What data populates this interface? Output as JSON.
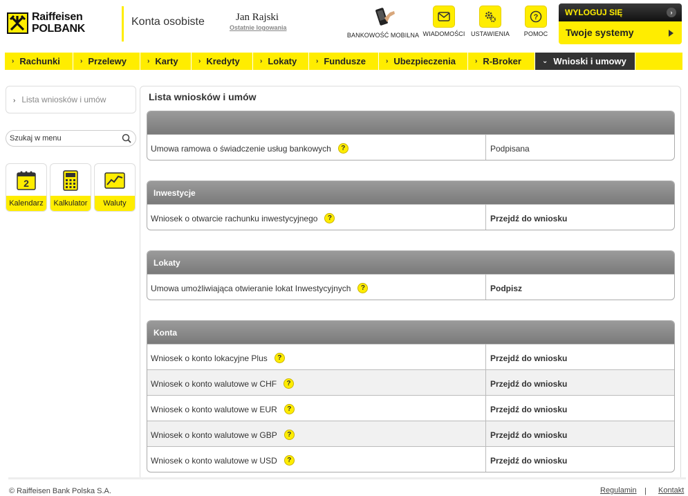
{
  "brand": {
    "line1": "Raiffeisen",
    "line2": "POLBANK",
    "accent": "#ffed00",
    "dark": "#333333"
  },
  "header": {
    "section_title": "Konta osobiste",
    "user_name": "Jan Rajski",
    "last_login_link": "Ostatnie logowania",
    "icons": [
      {
        "name": "mobile-banking-icon",
        "label": "BANKOWOŚĆ MOBILNA"
      },
      {
        "name": "messages-icon",
        "label": "WIADOMOŚCI"
      },
      {
        "name": "settings-icon",
        "label": "USTAWIENIA"
      },
      {
        "name": "help-icon",
        "label": "POMOC"
      }
    ],
    "logout_label": "WYLOGUJ SIĘ",
    "systems_label": "Twoje systemy"
  },
  "nav": {
    "items": [
      {
        "label": "Rachunki"
      },
      {
        "label": "Przelewy"
      },
      {
        "label": "Karty"
      },
      {
        "label": "Kredyty"
      },
      {
        "label": "Lokaty"
      },
      {
        "label": "Fundusze"
      },
      {
        "label": "Ubezpieczenia"
      },
      {
        "label": "R-Broker"
      },
      {
        "label": "Wnioski i umowy",
        "active": true
      }
    ]
  },
  "sidebar": {
    "menu_item": "Lista wniosków i umów",
    "search_placeholder": "Szukaj w menu",
    "tools": [
      {
        "label": "Kalendarz",
        "icon": "calendar-icon"
      },
      {
        "label": "Kalkulator",
        "icon": "calculator-icon"
      },
      {
        "label": "Waluty",
        "icon": "currency-chart-icon"
      }
    ]
  },
  "main": {
    "title": "Lista wniosków i umów",
    "groups": [
      {
        "title": "",
        "rows": [
          {
            "name": "Umowa ramowa o świadczenie usług bankowych",
            "action": "Podpisana",
            "bold": false
          }
        ]
      },
      {
        "title": "Inwestycje",
        "rows": [
          {
            "name": "Wniosek o otwarcie rachunku inwestycyjnego",
            "action": "Przejdź do wniosku",
            "bold": true
          }
        ]
      },
      {
        "title": "Lokaty",
        "rows": [
          {
            "name": "Umowa umożliwiająca otwieranie lokat Inwestycyjnych",
            "action": "Podpisz",
            "bold": true
          }
        ]
      },
      {
        "title": "Konta",
        "rows": [
          {
            "name": "Wniosek o konto lokacyjne Plus",
            "action": "Przejdź do wniosku",
            "bold": true
          },
          {
            "name": "Wniosek o konto walutowe w CHF",
            "action": "Przejdź do wniosku",
            "bold": true
          },
          {
            "name": "Wniosek o konto walutowe w EUR",
            "action": "Przejdź do wniosku",
            "bold": true
          },
          {
            "name": "Wniosek o konto walutowe w GBP",
            "action": "Przejdź do wniosku",
            "bold": true
          },
          {
            "name": "Wniosek o konto walutowe w USD",
            "action": "Przejdź do wniosku",
            "bold": true
          }
        ]
      }
    ]
  },
  "footer": {
    "copyright": "© Raiffeisen Bank Polska S.A.",
    "links": [
      "Regulamin",
      "Kontakt"
    ],
    "separator": "|"
  }
}
